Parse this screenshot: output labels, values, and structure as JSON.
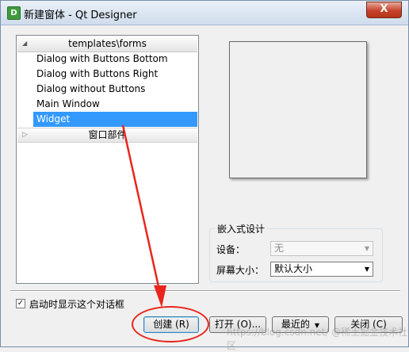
{
  "window": {
    "app_icon": "D",
    "title": "新建窗体 - Qt Designer",
    "close_label": "X"
  },
  "templates": {
    "header": "templates\\forms",
    "items": [
      "Dialog with Buttons Bottom",
      "Dialog with Buttons Right",
      "Dialog without Buttons",
      "Main Window",
      "Widget"
    ],
    "selected": "Widget",
    "widgets_header": "窗口部件"
  },
  "embedded": {
    "title": "嵌入式设计",
    "device_label": "设备：",
    "device_value": "无",
    "screen_size_label": "屏幕大小：",
    "screen_size_value": "默认大小"
  },
  "startup_checkbox": {
    "label": "启动时显示这个对话框",
    "checked": true
  },
  "buttons": {
    "create": "创建 (R)",
    "open": "打开 (O)...",
    "recent": "最近的",
    "close": "关闭 (C)"
  },
  "watermark": "https://blog.csdn.net/ @稀土掘金技术社区",
  "colors": {
    "selection": "#3399ff",
    "annotation": "#e8261c"
  }
}
